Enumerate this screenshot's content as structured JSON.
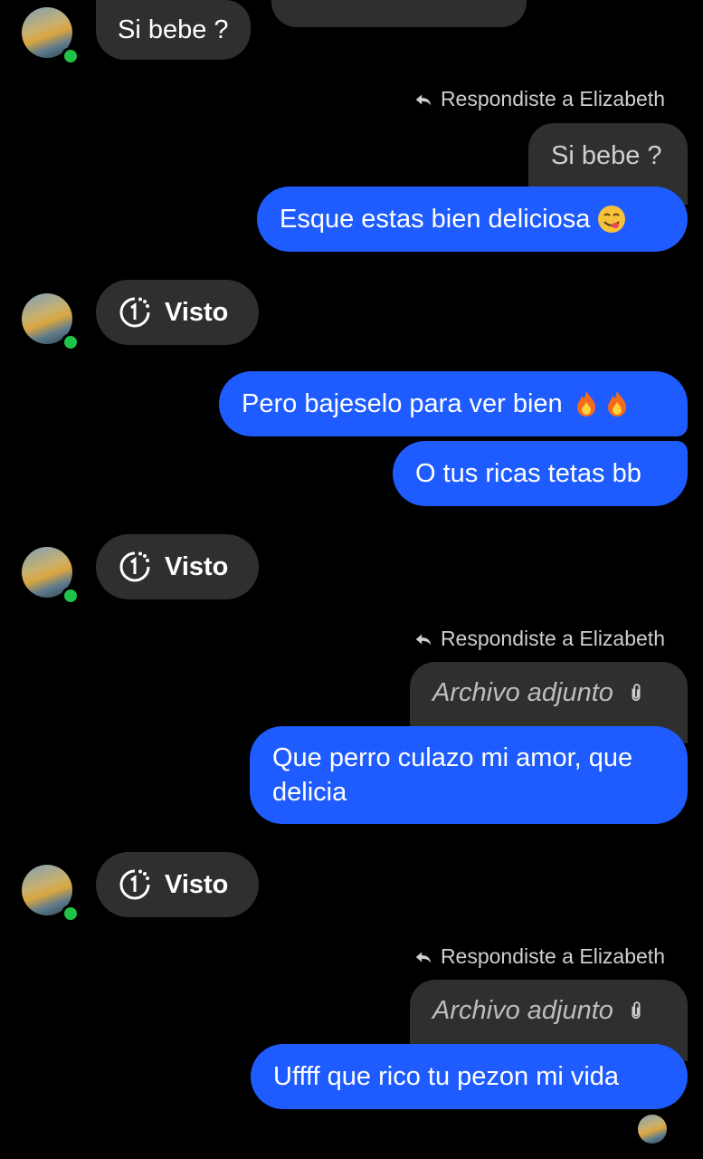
{
  "messages": {
    "in_top": "Si bebe ?",
    "reply1": {
      "header": "Respondiste a Elizabeth",
      "quoted": "Si bebe ?",
      "text": "Esque estas bien deliciosa"
    },
    "seen1": "Visto",
    "out1": "Pero bajeselo para ver bien",
    "out2": "O tus ricas tetas bb",
    "seen2": "Visto",
    "reply2": {
      "header": "Respondiste a Elizabeth",
      "quoted": "Archivo adjunto",
      "text_line1": "Que perro culazo mi amor, que",
      "text_line2": "delicia"
    },
    "seen3": "Visto",
    "reply3": {
      "header": "Respondiste a Elizabeth",
      "quoted": "Archivo adjunto",
      "text": "Uffff que rico tu pezon mi vida"
    }
  },
  "colors": {
    "background": "#000000",
    "incoming_bubble": "#2f2f2f",
    "outgoing_bubble": "#1e5cff",
    "online": "#1fc347"
  },
  "icons": [
    "reply-arrow-icon",
    "view-once-icon",
    "attachment-clip-icon",
    "savoring-food-emoji",
    "fire-emoji"
  ]
}
